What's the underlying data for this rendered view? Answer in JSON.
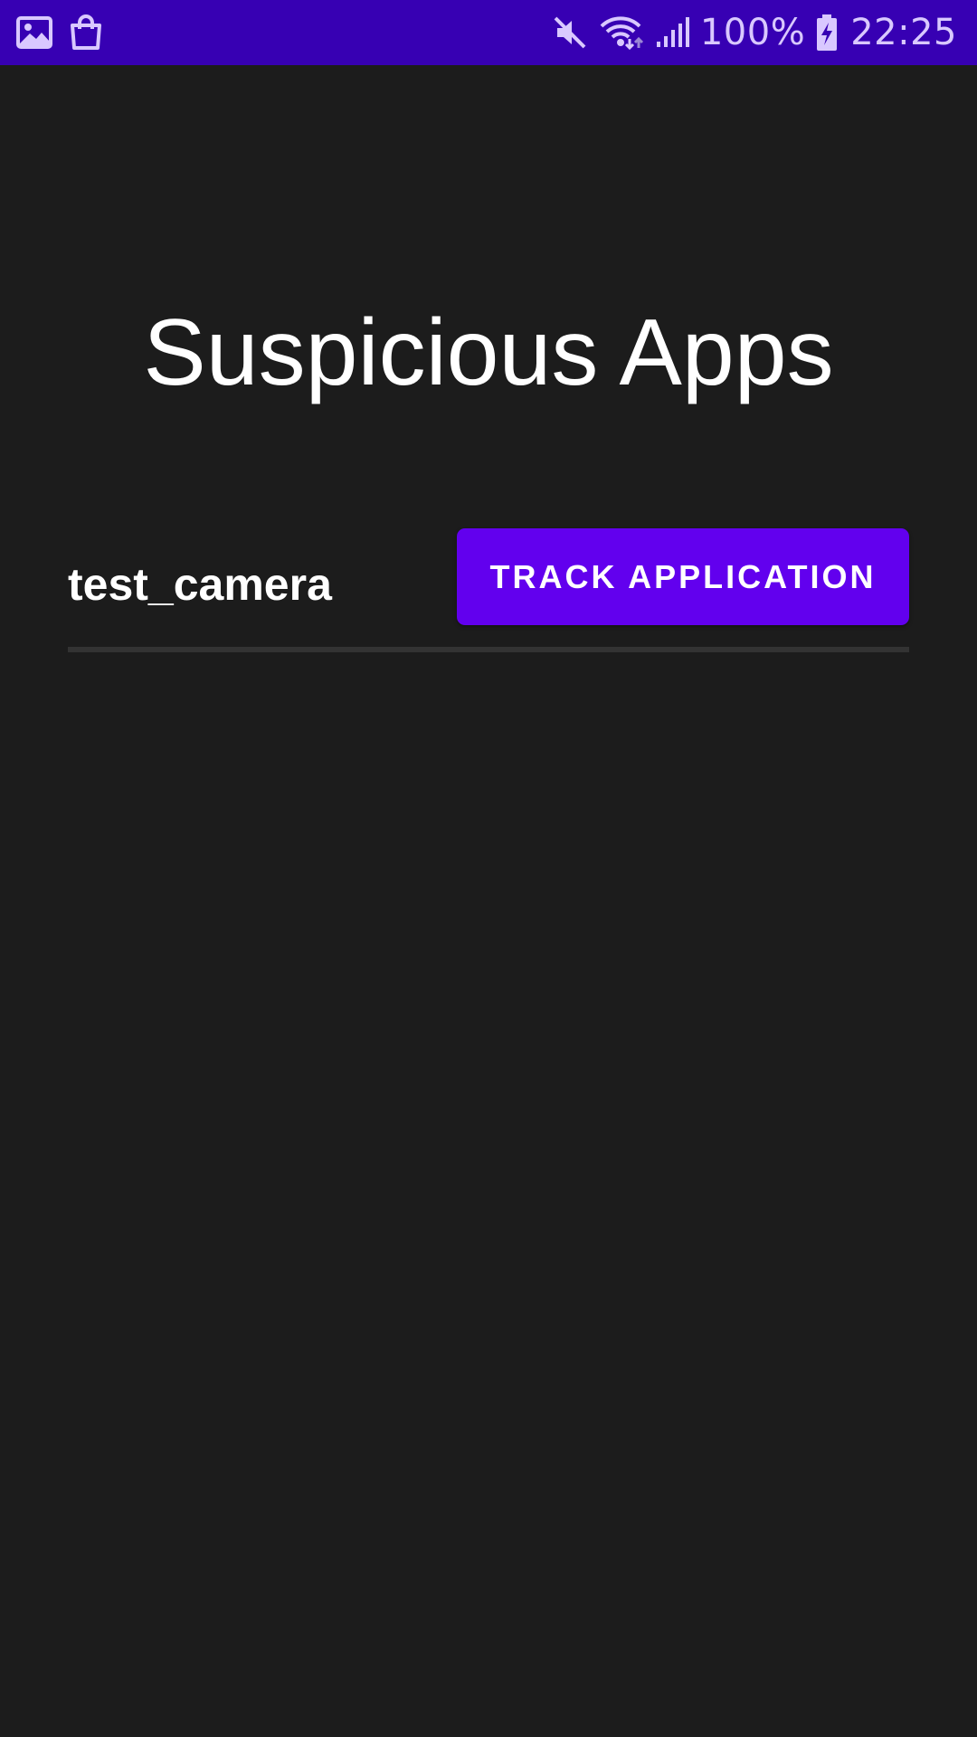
{
  "status_bar": {
    "battery_percent": "100%",
    "time": "22:25",
    "background_color": "#3700b3",
    "icons_left": [
      "gallery-icon",
      "shopping-bag-icon"
    ],
    "icons_right": [
      "mute-icon",
      "wifi-icon",
      "cellular-signal-icon",
      "battery-charging-icon"
    ]
  },
  "page": {
    "title": "Suspicious Apps",
    "background_color": "#1c1c1c"
  },
  "apps": [
    {
      "name": "test_camera",
      "action_label": "TRACK APPLICATION"
    }
  ],
  "accent_color": "#6200ee"
}
